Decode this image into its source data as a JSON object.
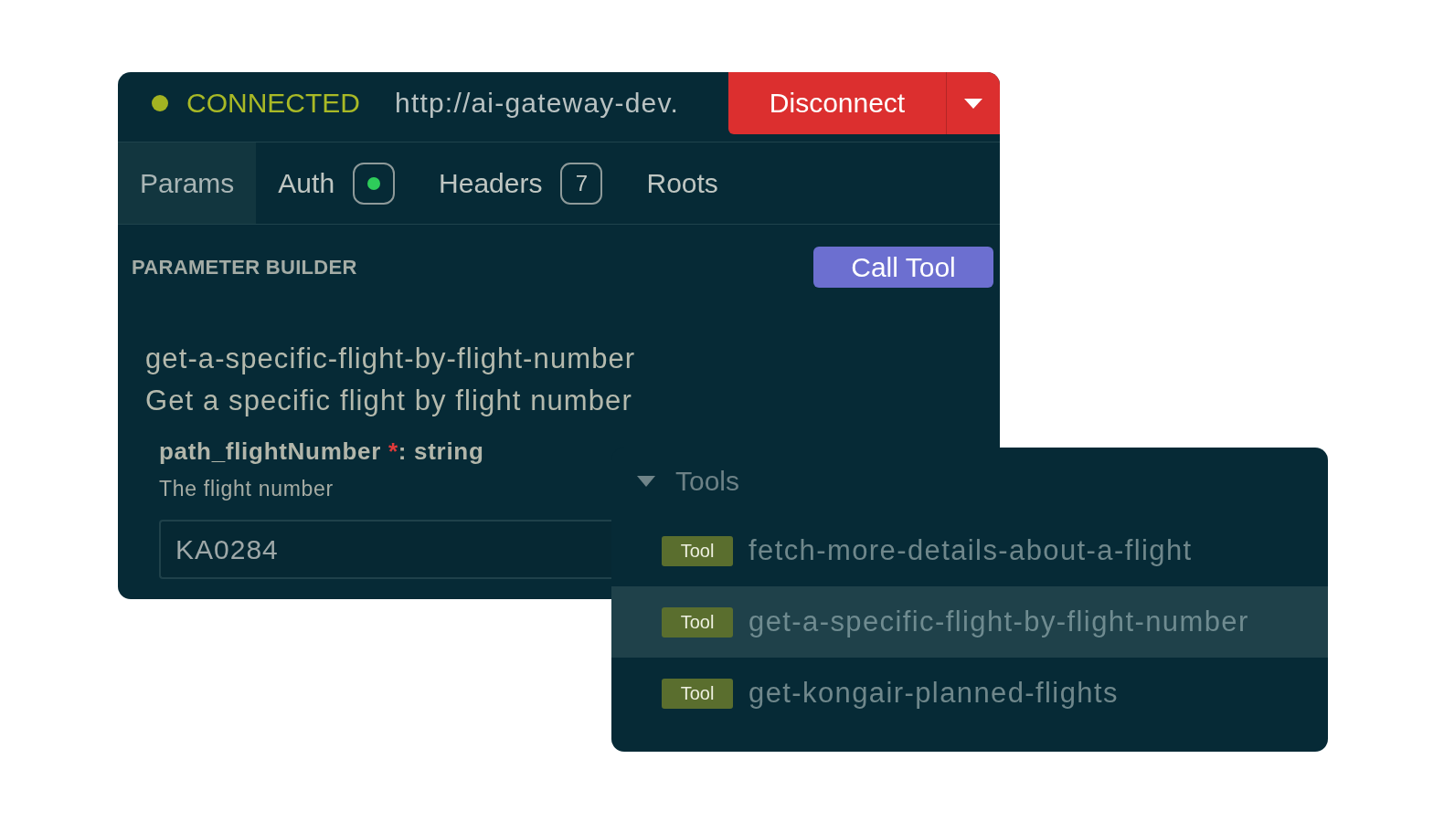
{
  "connection": {
    "connected": true,
    "status": "CONNECTED",
    "url": "http://ai-gateway-dev."
  },
  "disconnect_button": {
    "label": "Disconnect"
  },
  "tabs": [
    {
      "label": "Params",
      "selected": true,
      "kind": "plain"
    },
    {
      "label": "Auth",
      "selected": false,
      "kind": "status",
      "status": {
        "on": true
      }
    },
    {
      "label": "Headers",
      "selected": false,
      "kind": "count",
      "count": "7"
    },
    {
      "label": "Roots",
      "selected": false,
      "kind": "plain"
    }
  ],
  "parameter_builder": {
    "title": "PARAMETER BUILDER",
    "call_button": "Call Tool",
    "tool_name": "get-a-specific-flight-by-flight-number",
    "tool_description": "Get a specific flight by flight number",
    "fields": [
      {
        "name": "path_flightNumber",
        "required_mark": "*",
        "type": ": string",
        "description": "The flight number",
        "value": "KA0284"
      }
    ]
  },
  "tools_panel": {
    "header": "Tools",
    "expanded": true,
    "items": [
      {
        "tag": "Tool",
        "name": "fetch-more-details-about-a-flight",
        "selected": false
      },
      {
        "tag": "Tool",
        "name": "get-a-specific-flight-by-flight-number",
        "selected": true
      },
      {
        "tag": "Tool",
        "name": "get-kongair-planned-flights",
        "selected": false
      }
    ]
  }
}
